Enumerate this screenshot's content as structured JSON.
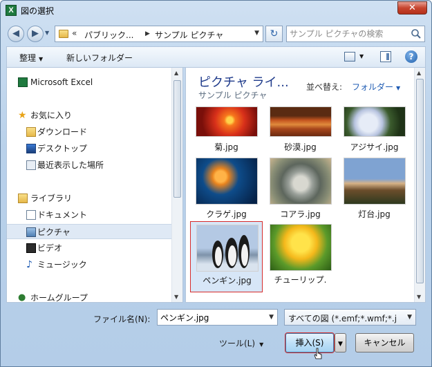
{
  "window": {
    "title": "図の選択",
    "close_label": "✕",
    "app_icon_label": "X"
  },
  "address": {
    "parts": [
      "パブリック...",
      "サンプル ピクチャ"
    ],
    "chevron": "«"
  },
  "search": {
    "placeholder": "サンプル ピクチャの検索"
  },
  "toolbar": {
    "organize_label": "整理",
    "new_folder_label": "新しいフォルダー"
  },
  "navpane": {
    "items": [
      {
        "label": "Microsoft Excel",
        "icon": "excel-icon"
      },
      {
        "label": "お気に入り",
        "icon": "star-icon"
      },
      {
        "label": "ダウンロード",
        "icon": "download-folder-icon"
      },
      {
        "label": "デスクトップ",
        "icon": "desktop-icon"
      },
      {
        "label": "最近表示した場所",
        "icon": "recent-places-icon"
      },
      {
        "label": "ライブラリ",
        "icon": "library-icon"
      },
      {
        "label": "ドキュメント",
        "icon": "documents-icon"
      },
      {
        "label": "ピクチャ",
        "icon": "pictures-icon",
        "selected": true
      },
      {
        "label": "ビデオ",
        "icon": "video-icon"
      },
      {
        "label": "ミュージック",
        "icon": "music-icon"
      },
      {
        "label": "ホームグループ",
        "icon": "homegroup-icon"
      }
    ]
  },
  "content": {
    "library_title": "ピクチャ ライ...",
    "library_subtitle": "サンプル ピクチャ",
    "sort_label": "並べ替え:",
    "sort_value": "フォルダー",
    "files": [
      {
        "name": "菊.jpg",
        "selected": false
      },
      {
        "name": "砂漠.jpg",
        "selected": false
      },
      {
        "name": "アジサイ.jpg",
        "selected": false
      },
      {
        "name": "クラゲ.jpg",
        "selected": false
      },
      {
        "name": "コアラ.jpg",
        "selected": false
      },
      {
        "name": "灯台.jpg",
        "selected": false
      },
      {
        "name": "ペンギン.jpg",
        "selected": true
      },
      {
        "name": "チューリップ.",
        "selected": false
      }
    ]
  },
  "footer": {
    "filename_label": "ファイル名(N):",
    "filename_value": "ペンギン.jpg",
    "filter_value": "すべての図 (*.emf;*.wmf;*.j",
    "tools_label": "ツール(L)",
    "insert_label": "挿入(S)",
    "cancel_label": "キャンセル"
  },
  "colors": {
    "accent": "#1e5bb3",
    "selection_outline": "#d62a2a",
    "title_blue": "#1e3a8a"
  }
}
